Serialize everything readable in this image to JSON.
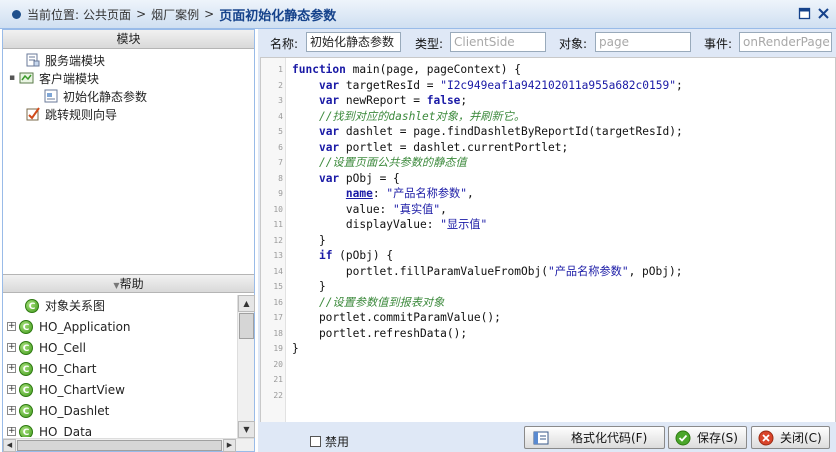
{
  "breadcrumb": {
    "prefix": "当前位置:",
    "items": [
      "公共页面",
      "烟厂案例"
    ],
    "separator": ">",
    "current": "页面初始化静态参数"
  },
  "left_panel": {
    "modules_title": "模块",
    "tree": [
      {
        "label": "服务端模块",
        "icon": "server-module-icon"
      },
      {
        "label": "客户端模块",
        "icon": "client-module-icon"
      },
      {
        "label": "初始化静态参数",
        "icon": "page-module-icon"
      },
      {
        "label": "跳转规则向导",
        "icon": "wizard-icon"
      }
    ],
    "help_title": "帮助",
    "help_items": [
      {
        "label": "对象关系图",
        "expandable": false
      },
      {
        "label": "HO_Application",
        "expandable": true
      },
      {
        "label": "HO_Cell",
        "expandable": true
      },
      {
        "label": "HO_Chart",
        "expandable": true
      },
      {
        "label": "HO_ChartView",
        "expandable": true
      },
      {
        "label": "HO_Dashlet",
        "expandable": true
      },
      {
        "label": "HO_Data",
        "expandable": true
      }
    ]
  },
  "props": {
    "name_label": "名称:",
    "name_value": "初始化静态参数",
    "type_label": "类型:",
    "type_placeholder": "ClientSide",
    "object_label": "对象:",
    "object_placeholder": "page",
    "event_label": "事件:",
    "event_placeholder": "onRenderPage"
  },
  "code_lines": [
    [
      {
        "t": "kw",
        "v": "function"
      },
      {
        "t": "txt",
        "v": " main(page, pageContext) {"
      }
    ],
    [
      {
        "t": "txt",
        "v": "    "
      },
      {
        "t": "kw",
        "v": "var"
      },
      {
        "t": "txt",
        "v": " targetResId = "
      },
      {
        "t": "str",
        "v": "\"I2c949eaf1a942102011a955a682c0159\""
      },
      {
        "t": "txt",
        "v": ";"
      }
    ],
    [
      {
        "t": "txt",
        "v": "    "
      },
      {
        "t": "kw",
        "v": "var"
      },
      {
        "t": "txt",
        "v": " newReport = "
      },
      {
        "t": "kw",
        "v": "false"
      },
      {
        "t": "txt",
        "v": ";"
      }
    ],
    [
      {
        "t": "txt",
        "v": "    "
      },
      {
        "t": "com",
        "v": "//找到对应的dashlet对象，并刷新它。"
      }
    ],
    [
      {
        "t": "txt",
        "v": "    "
      },
      {
        "t": "kw",
        "v": "var"
      },
      {
        "t": "txt",
        "v": " dashlet = page.findDashletByReportId(targetResId);"
      }
    ],
    [
      {
        "t": "txt",
        "v": "    "
      },
      {
        "t": "kw",
        "v": "var"
      },
      {
        "t": "txt",
        "v": " portlet = dashlet.currentPortlet;"
      }
    ],
    [
      {
        "t": "txt",
        "v": "    "
      },
      {
        "t": "com",
        "v": "//设置页面公共参数的静态值"
      }
    ],
    [
      {
        "t": "txt",
        "v": "    "
      },
      {
        "t": "kw",
        "v": "var"
      },
      {
        "t": "txt",
        "v": " pObj = {"
      }
    ],
    [
      {
        "t": "txt",
        "v": "        "
      },
      {
        "t": "prop",
        "v": "name"
      },
      {
        "t": "txt",
        "v": ": "
      },
      {
        "t": "str",
        "v": "\"产品名称参数\""
      },
      {
        "t": "txt",
        "v": ","
      }
    ],
    [
      {
        "t": "txt",
        "v": "        value: "
      },
      {
        "t": "str",
        "v": "\"真实值\""
      },
      {
        "t": "txt",
        "v": ","
      }
    ],
    [
      {
        "t": "txt",
        "v": "        displayValue: "
      },
      {
        "t": "str",
        "v": "\"显示值\""
      }
    ],
    [
      {
        "t": "txt",
        "v": "    }"
      }
    ],
    [
      {
        "t": "txt",
        "v": "    "
      },
      {
        "t": "kw",
        "v": "if"
      },
      {
        "t": "txt",
        "v": " (pObj) {"
      }
    ],
    [
      {
        "t": "txt",
        "v": "        portlet.fillParamValueFromObj("
      },
      {
        "t": "str",
        "v": "\"产品名称参数\""
      },
      {
        "t": "txt",
        "v": ", pObj);"
      }
    ],
    [
      {
        "t": "txt",
        "v": "    }"
      }
    ],
    [
      {
        "t": "txt",
        "v": "    "
      },
      {
        "t": "com",
        "v": "//设置参数值到报表对象"
      }
    ],
    [
      {
        "t": "txt",
        "v": "    portlet.commitParamValue();"
      }
    ],
    [
      {
        "t": "txt",
        "v": "    portlet.refreshData();"
      }
    ],
    [
      {
        "t": "txt",
        "v": "}"
      }
    ],
    [],
    [],
    []
  ],
  "footer": {
    "disable_label": "禁用",
    "format_button": "格式化代码(F)",
    "save_button": "保存(S)",
    "close_button": "关闭(C)"
  }
}
